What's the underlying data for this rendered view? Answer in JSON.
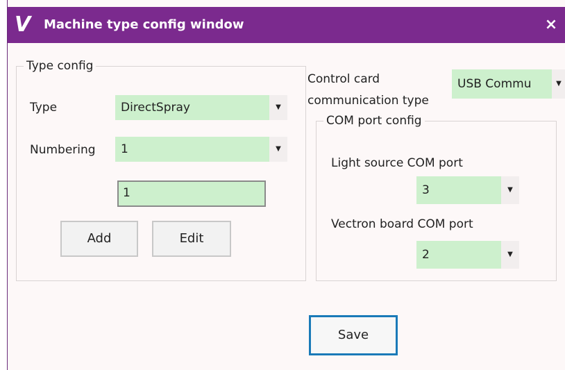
{
  "window": {
    "title": "Machine type config window",
    "icon_glyph": "V",
    "close_glyph": "×",
    "accent_color": "#7b2a8e",
    "field_color": "#cdf0cd"
  },
  "type_config": {
    "legend": "Type config",
    "type_label": "Type",
    "type_value": "DirectSpray",
    "numbering_label": "Numbering",
    "numbering_value": "1",
    "text_value": "1",
    "add_label": "Add",
    "edit_label": "Edit"
  },
  "communication": {
    "label_line1": "Control card",
    "label_line2": "communication type",
    "value": "USB Commu"
  },
  "com_port_config": {
    "legend": "COM port config",
    "light_source_label": "Light source COM port",
    "light_source_value": "3",
    "vectron_label": "Vectron board COM port",
    "vectron_value": "2"
  },
  "footer": {
    "save_label": "Save"
  },
  "icons": {
    "dropdown": "chevron-down-icon",
    "close": "close-icon",
    "app": "app-logo-icon"
  }
}
